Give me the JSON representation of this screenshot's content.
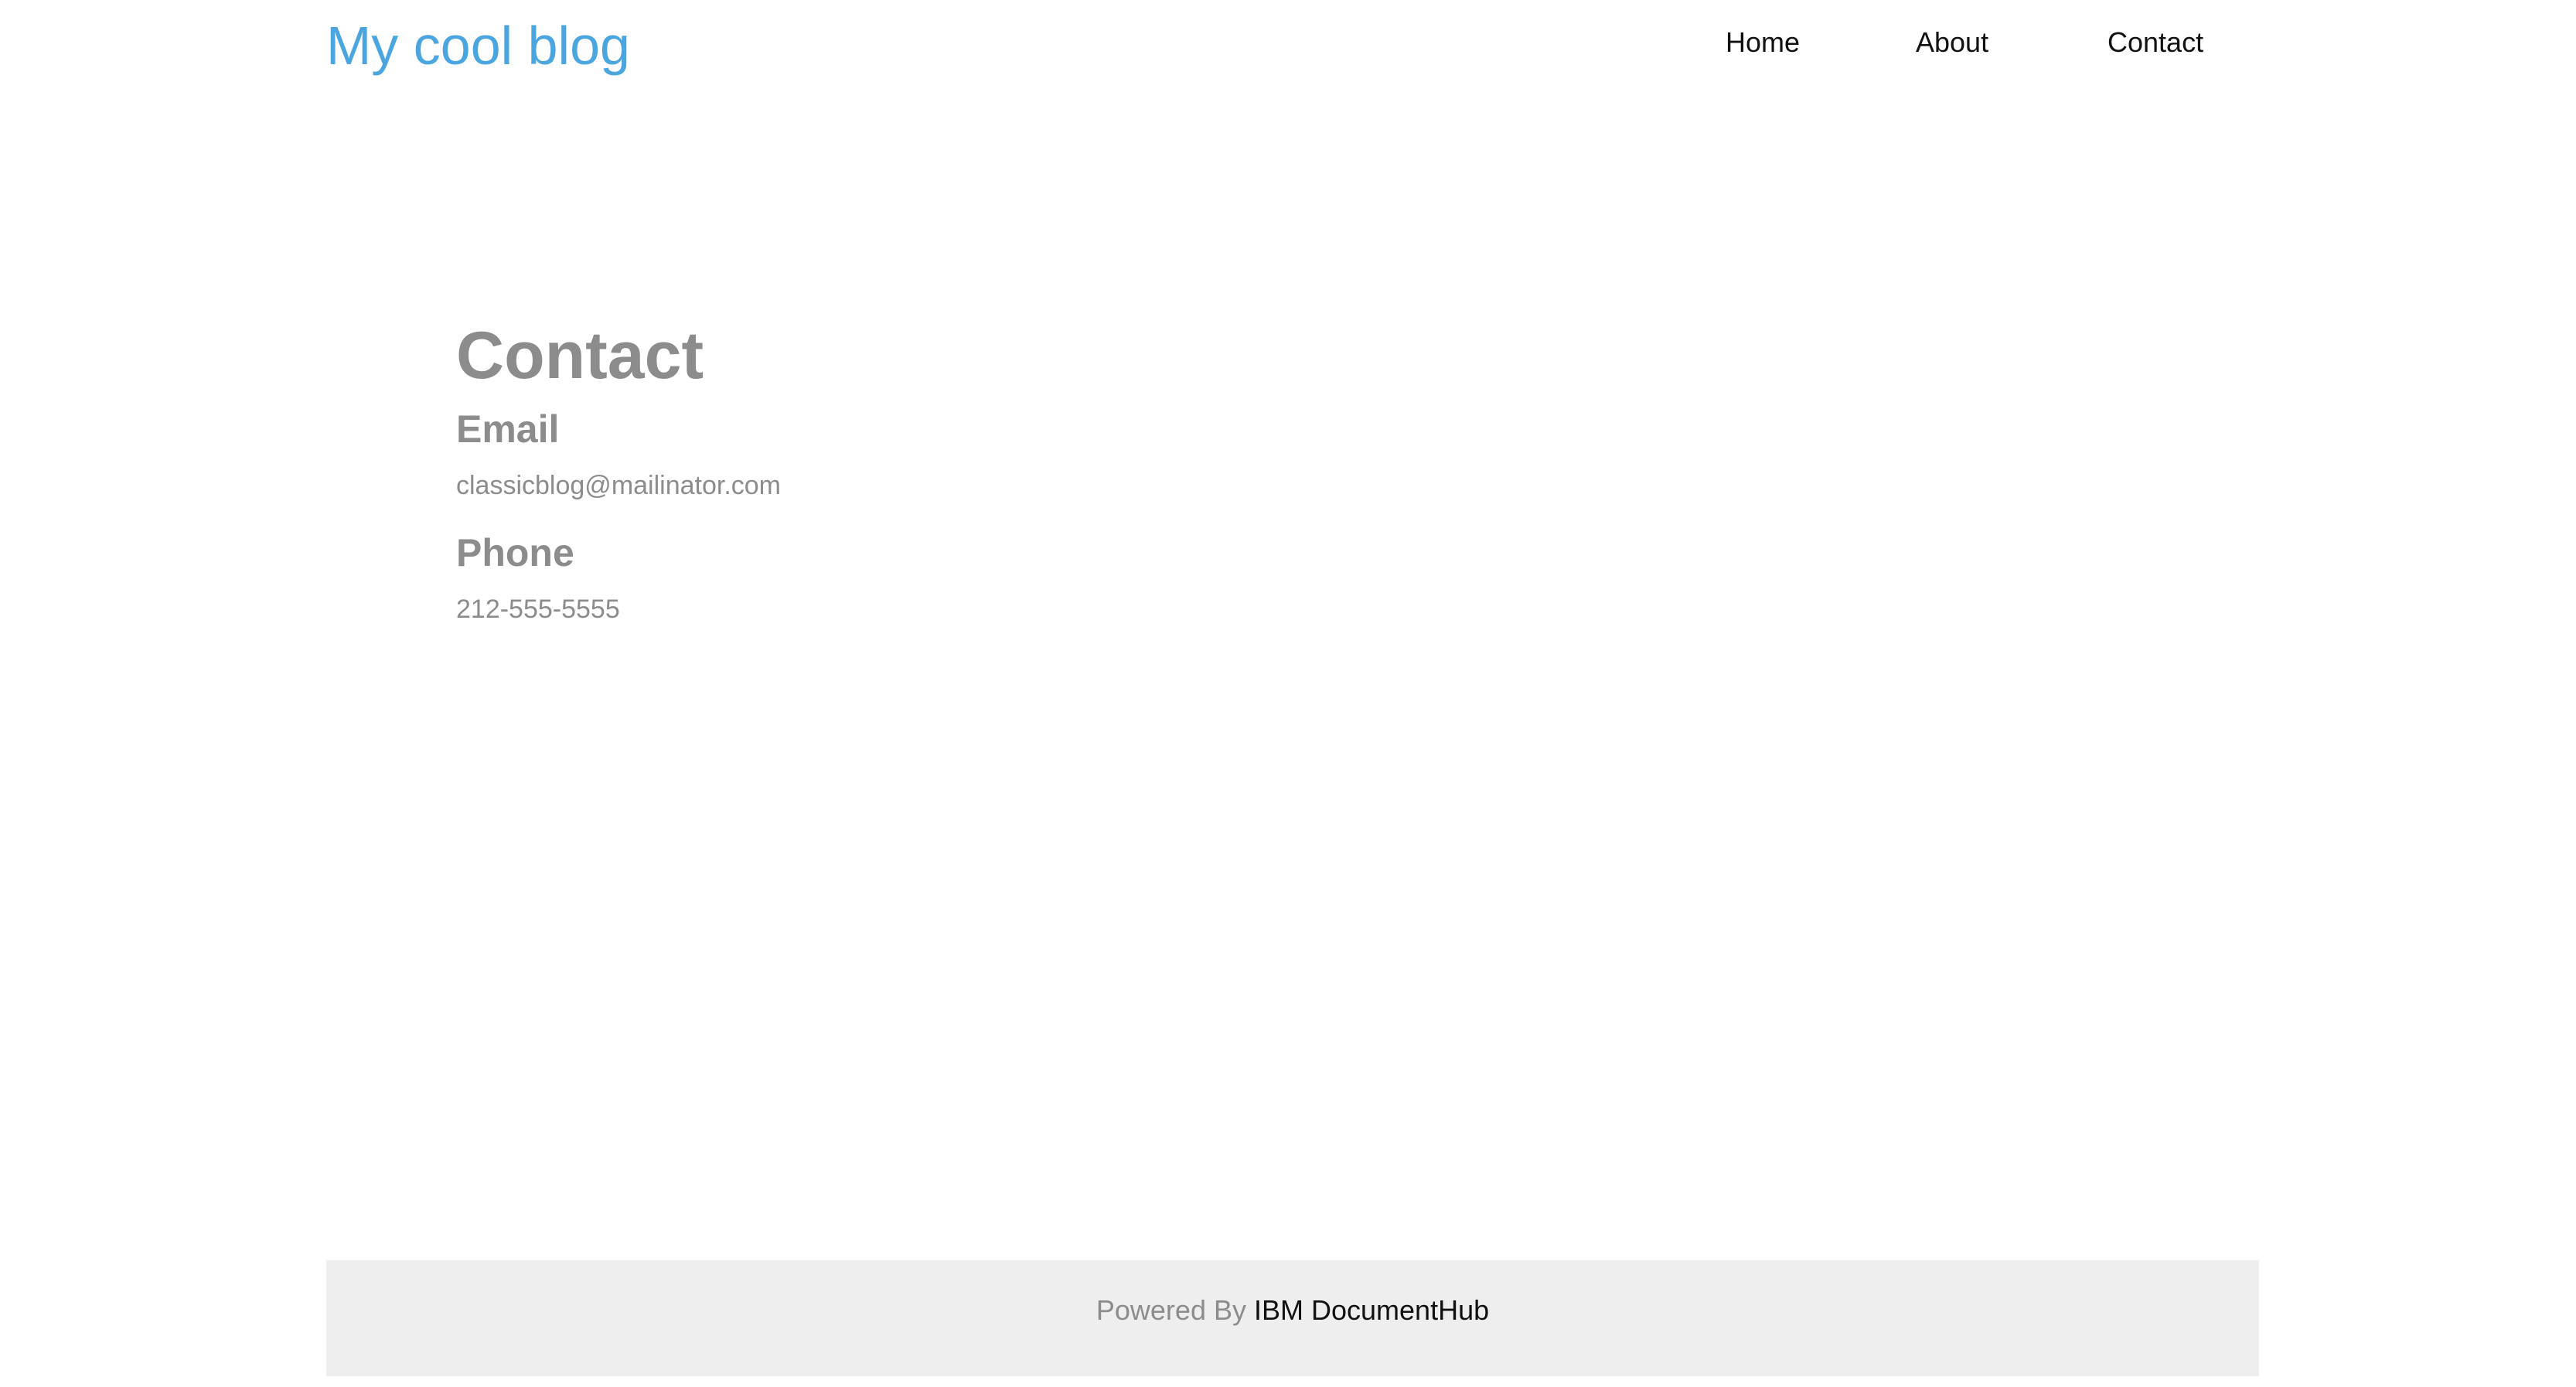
{
  "header": {
    "site_title": "My cool blog",
    "nav": {
      "home": "Home",
      "about": "About",
      "contact": "Contact"
    }
  },
  "main": {
    "title": "Contact",
    "email": {
      "heading": "Email",
      "value": "classicblog@mailinator.com"
    },
    "phone": {
      "heading": "Phone",
      "value": "212-555-5555"
    }
  },
  "footer": {
    "prefix": "Powered By",
    "link": "IBM DocumentHub"
  },
  "colors": {
    "brand": "#4ba6e0",
    "text_muted": "#8c8c8c",
    "text_dark": "#111111",
    "footer_bg": "#eeeeee"
  }
}
